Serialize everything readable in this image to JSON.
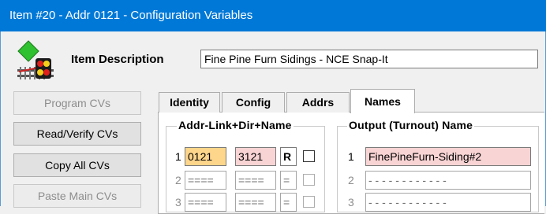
{
  "window": {
    "title": "Item #20 - Addr 0121 - Configuration Variables"
  },
  "icon": {
    "name": "turnout-signal-icon"
  },
  "description": {
    "label": "Item Description",
    "value": "Fine Pine Furn Sidings - NCE Snap-It"
  },
  "buttons": {
    "program": "Program CVs",
    "read_verify": "Read/Verify CVs",
    "copy_all": "Copy All CVs",
    "paste_main": "Paste Main CVs"
  },
  "tabs": [
    "Identity",
    "Config",
    "Addrs",
    "Names"
  ],
  "active_tab": "Names",
  "addr_group": {
    "title": "Addr-Link+Dir+Name",
    "rows": [
      {
        "num": "1",
        "addr": "0121",
        "link": "3121",
        "dir": "R",
        "checked": false
      },
      {
        "num": "2",
        "addr": "====",
        "link": "====",
        "dir": "=",
        "checked": false
      },
      {
        "num": "3",
        "addr": "====",
        "link": "====",
        "dir": "=",
        "checked": false
      }
    ]
  },
  "output_group": {
    "title": "Output (Turnout) Name",
    "rows": [
      {
        "num": "1",
        "name": "FinePineFurn-Siding#2"
      },
      {
        "num": "2",
        "name": "- - - - - - - - - - - -"
      },
      {
        "num": "3",
        "name": "- - - - - - - - - - - -"
      }
    ]
  },
  "colors": {
    "titlebar": "#0078d7",
    "highlight_yellow": "#fdd58b",
    "highlight_pink": "#f9d4d4"
  }
}
